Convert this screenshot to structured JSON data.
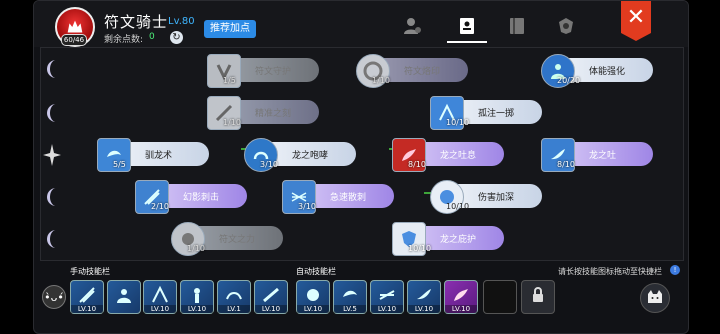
{
  "header": {
    "emblem_badge": "60/46",
    "title": "符文骑士",
    "level": "Lv.80",
    "points_label": "剩余点数:",
    "points_value": "0",
    "recommend_label": "推荐加点",
    "tabs": [
      "tab-character-icon",
      "tab-skill-book-icon",
      "tab-journal-icon",
      "tab-emblem-icon"
    ],
    "close_label": "✕"
  },
  "colors": {
    "accent": "#2c8be6",
    "connector": "#3ea53a",
    "close": "#e23b1f",
    "points": "#4cf07a"
  },
  "skills": [
    {
      "name": "符文守护",
      "level": "1/5",
      "locked": true
    },
    {
      "name": "符文烙印",
      "level": "1/10",
      "locked": true
    },
    {
      "name": "体能强化",
      "level": "20/20",
      "locked": false
    },
    {
      "name": "精准之刻",
      "level": "1/10",
      "locked": true
    },
    {
      "name": "孤注一掷",
      "level": "10/10",
      "locked": false
    },
    {
      "name": "驯龙术",
      "level": "5/5",
      "locked": false
    },
    {
      "name": "龙之咆哮",
      "level": "3/10",
      "locked": false
    },
    {
      "name": "龙之吐息",
      "level": "8/10",
      "locked": false
    },
    {
      "name": "龙之吐",
      "level": "8/10",
      "locked": false
    },
    {
      "name": "幻影刺击",
      "level": "2/10",
      "locked": false
    },
    {
      "name": "急速散刺",
      "level": "3/10",
      "locked": false
    },
    {
      "name": "伤害加深",
      "level": "10/10",
      "locked": false
    },
    {
      "name": "符文之力",
      "level": "1/10",
      "locked": true
    },
    {
      "name": "龙之庇护",
      "level": "10/10",
      "locked": false
    }
  ],
  "bottom": {
    "manual_label": "手动技能栏",
    "auto_label": "自动技能栏",
    "hint": "请长按技能图标拖动至快捷栏",
    "manual_slots": [
      "LV.10",
      "",
      "LV.10",
      "LV.10",
      "LV.1",
      "LV.10"
    ],
    "auto_slots": [
      "LV.10",
      "LV.5",
      "LV.10",
      "LV.10",
      "LV.10",
      "",
      ""
    ]
  }
}
